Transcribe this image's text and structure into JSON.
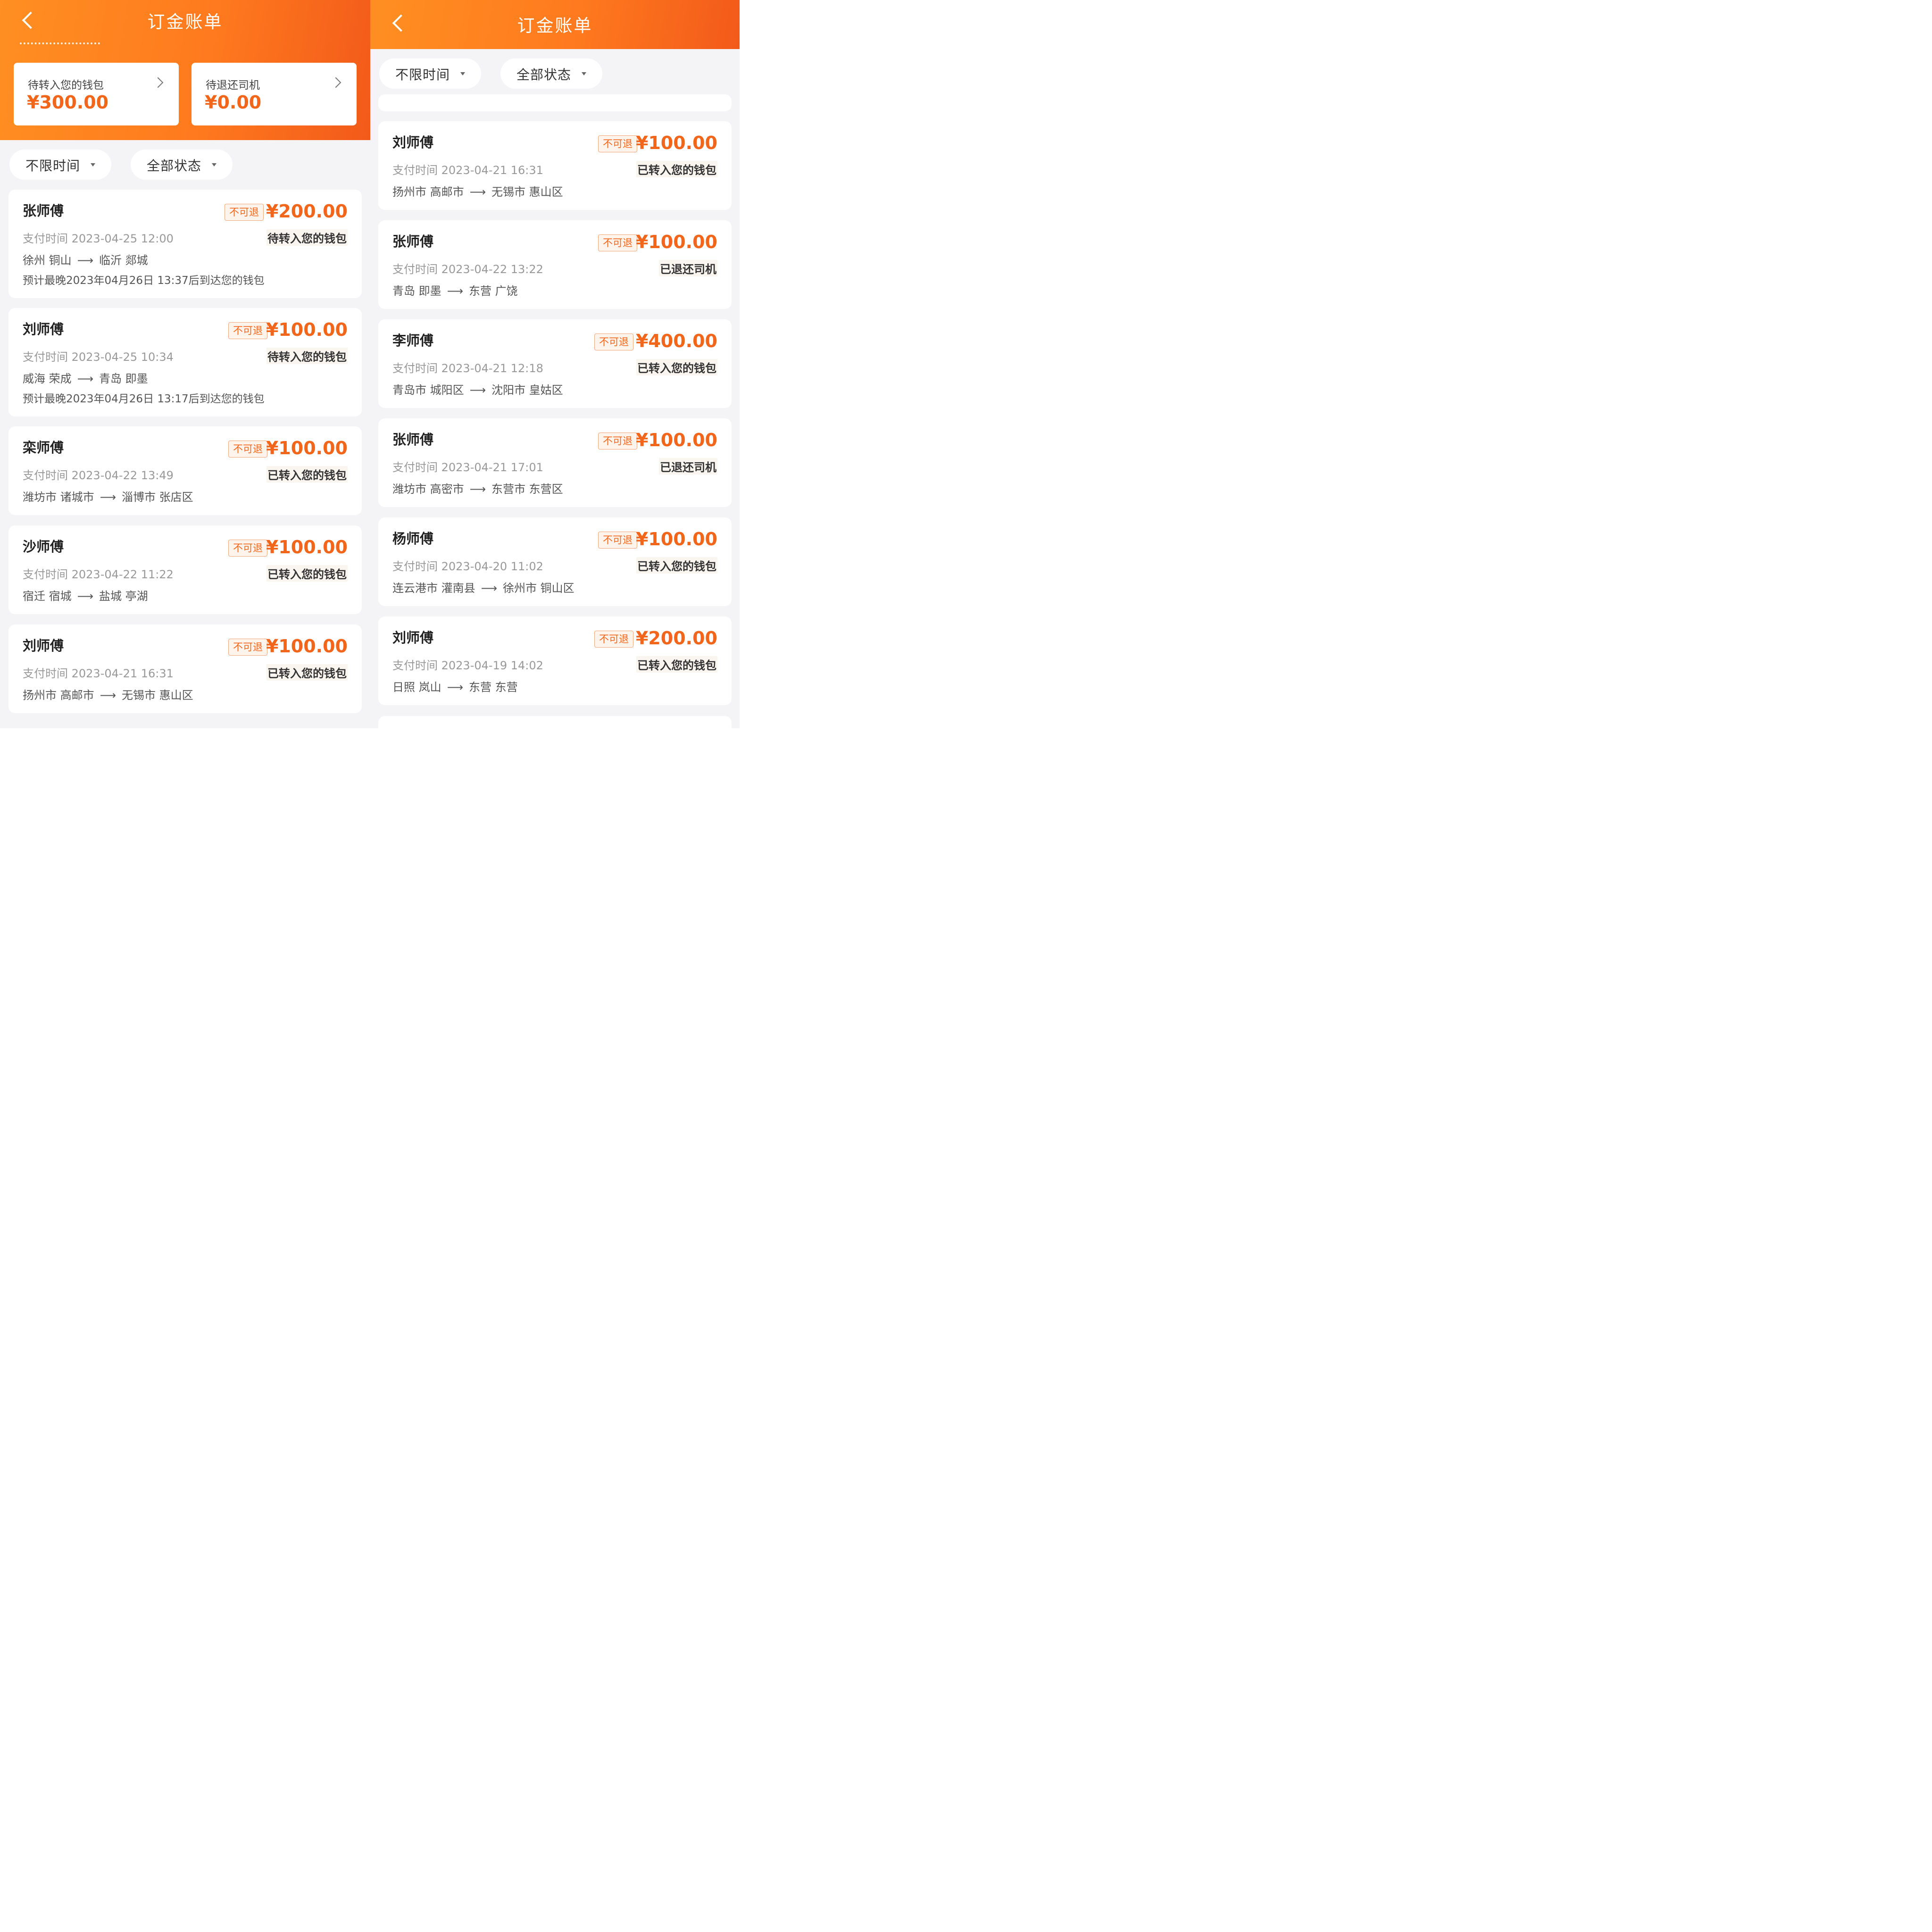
{
  "left": {
    "title": "订金账单",
    "summary": [
      {
        "label": "待转入您的钱包",
        "amount": "¥300.00"
      },
      {
        "label": "待退还司机",
        "amount": "¥0.00"
      }
    ],
    "filters": {
      "time": "不限时间",
      "status": "全部状态"
    },
    "records": [
      {
        "name": "张师傅",
        "tag": "不可退",
        "amount": "¥200.00",
        "time": "支付时间 2023-04-25 12:00",
        "status": "待转入您的钱包",
        "from": "徐州 铜山",
        "to": "临沂 郯城",
        "eta": "预计最晚2023年04月26日 13:37后到达您的钱包"
      },
      {
        "name": "刘师傅",
        "tag": "不可退",
        "amount": "¥100.00",
        "time": "支付时间 2023-04-25 10:34",
        "status": "待转入您的钱包",
        "from": "威海 荣成",
        "to": "青岛 即墨",
        "eta": "预计最晚2023年04月26日 13:17后到达您的钱包"
      },
      {
        "name": "栾师傅",
        "tag": "不可退",
        "amount": "¥100.00",
        "time": "支付时间 2023-04-22 13:49",
        "status": "已转入您的钱包",
        "from": "潍坊市 诸城市",
        "to": "淄博市 张店区",
        "eta": ""
      },
      {
        "name": "沙师傅",
        "tag": "不可退",
        "amount": "¥100.00",
        "time": "支付时间 2023-04-22 11:22",
        "status": "已转入您的钱包",
        "from": "宿迁 宿城",
        "to": "盐城 亭湖",
        "eta": ""
      },
      {
        "name": "刘师傅",
        "tag": "不可退",
        "amount": "¥100.00",
        "time": "支付时间 2023-04-21 16:31",
        "status": "已转入您的钱包",
        "from": "扬州市 高邮市",
        "to": "无锡市 惠山区",
        "eta": ""
      }
    ]
  },
  "right": {
    "title": "订金账单",
    "filters": {
      "time": "不限时间",
      "status": "全部状态"
    },
    "records": [
      {
        "name": "刘师傅",
        "tag": "不可退",
        "amount": "¥100.00",
        "time": "支付时间 2023-04-21 16:31",
        "status": "已转入您的钱包",
        "from": "扬州市 高邮市",
        "to": "无锡市 惠山区"
      },
      {
        "name": "张师傅",
        "tag": "不可退",
        "amount": "¥100.00",
        "time": "支付时间 2023-04-22 13:22",
        "status": "已退还司机",
        "from": "青岛 即墨",
        "to": "东营 广饶"
      },
      {
        "name": "李师傅",
        "tag": "不可退",
        "amount": "¥400.00",
        "time": "支付时间 2023-04-21 12:18",
        "status": "已转入您的钱包",
        "from": "青岛市 城阳区",
        "to": "沈阳市 皇姑区"
      },
      {
        "name": "张师傅",
        "tag": "不可退",
        "amount": "¥100.00",
        "time": "支付时间 2023-04-21 17:01",
        "status": "已退还司机",
        "from": "潍坊市 高密市",
        "to": "东营市 东营区"
      },
      {
        "name": "杨师傅",
        "tag": "不可退",
        "amount": "¥100.00",
        "time": "支付时间 2023-04-20 11:02",
        "status": "已转入您的钱包",
        "from": "连云港市 灌南县",
        "to": "徐州市 铜山区"
      },
      {
        "name": "刘师傅",
        "tag": "不可退",
        "amount": "¥200.00",
        "time": "支付时间 2023-04-19 14:02",
        "status": "已转入您的钱包",
        "from": "日照 岚山",
        "to": "东营 东营"
      }
    ]
  }
}
